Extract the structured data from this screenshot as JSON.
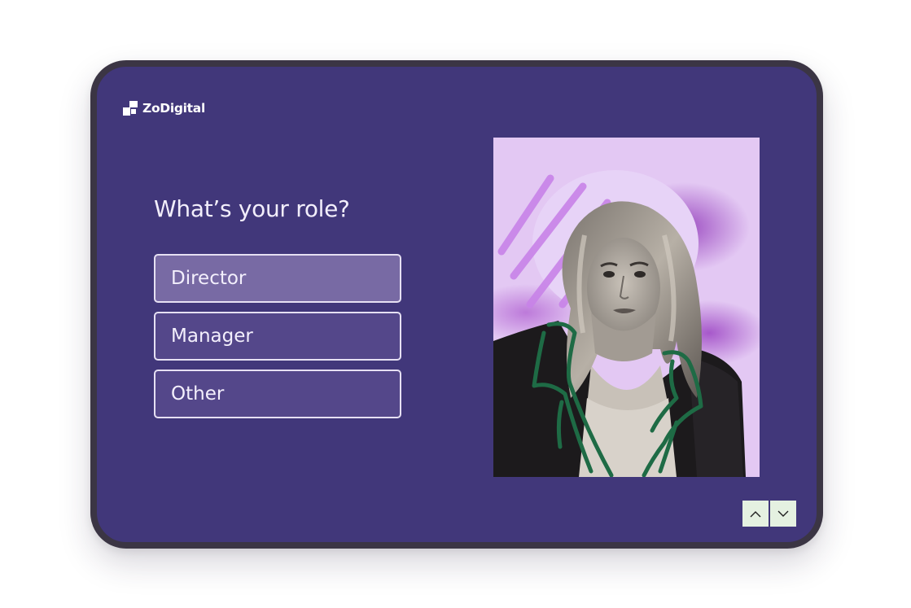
{
  "brand": {
    "name": "ZoDigital",
    "logo_icon": "zodigital-logo-icon"
  },
  "survey": {
    "question": "What’s your role?",
    "options": [
      {
        "label": "Director",
        "selected": true
      },
      {
        "label": "Manager",
        "selected": false
      },
      {
        "label": "Other",
        "selected": false
      }
    ]
  },
  "image": {
    "subject": "woman-portrait-photo"
  },
  "navigation": {
    "up_icon": "chevron-up-icon",
    "down_icon": "chevron-down-icon"
  },
  "colors": {
    "background": "#41377a",
    "frame": "#3b3544",
    "option_fill": "#54478a",
    "option_selected_fill": "#786aa4",
    "option_border": "#e6e0f3",
    "photo_bg": "#e3c8f3",
    "nav_button": "#e5f1e1",
    "sketch_accent": "#1e6b45"
  }
}
